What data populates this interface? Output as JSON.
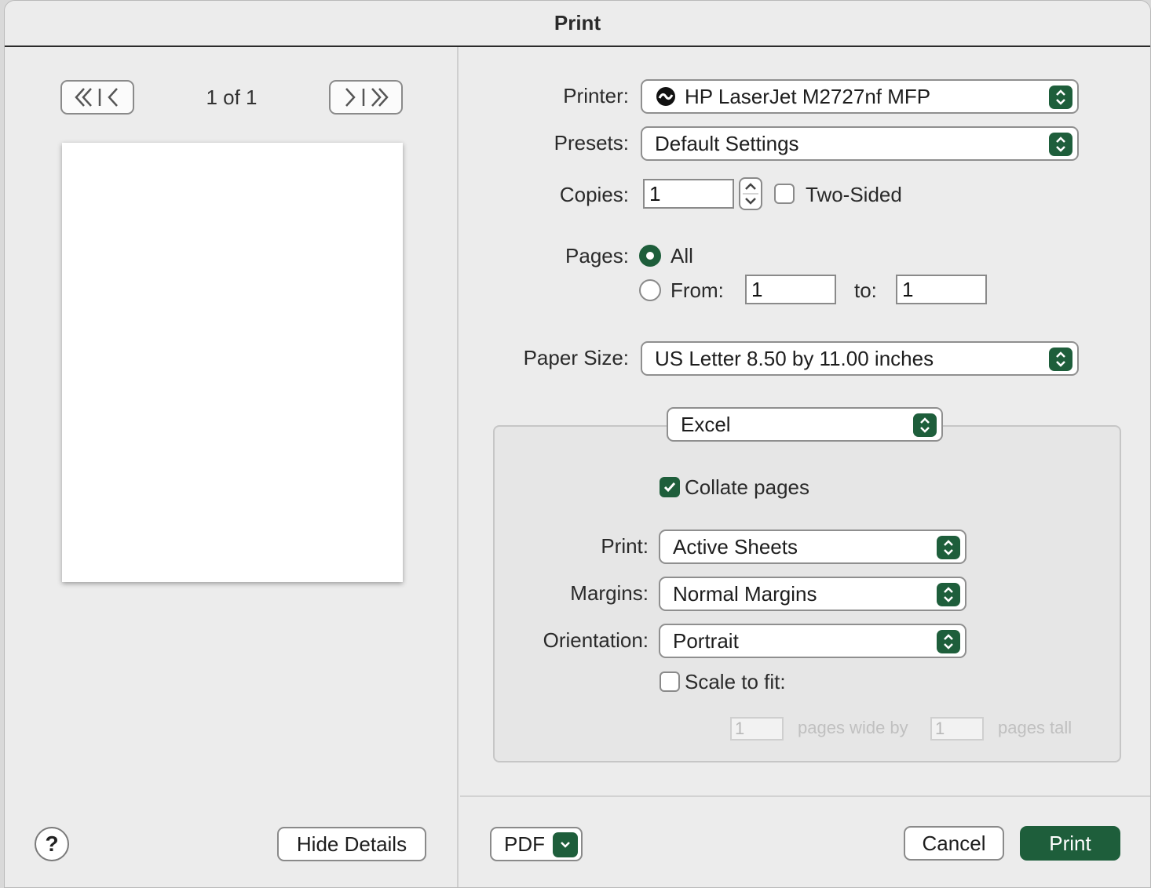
{
  "window": {
    "title": "Print"
  },
  "preview": {
    "page_indicator": "1 of 1"
  },
  "left_footer": {
    "help_label": "?",
    "hide_details_label": "Hide Details"
  },
  "printer": {
    "label": "Printer:",
    "value": "HP LaserJet M2727nf MFP"
  },
  "presets": {
    "label": "Presets:",
    "value": "Default Settings"
  },
  "copies": {
    "label": "Copies:",
    "value": "1",
    "two_sided_label": "Two-Sided",
    "two_sided_checked": false
  },
  "pages": {
    "label": "Pages:",
    "all_label": "All",
    "all_selected": true,
    "from_label": "From:",
    "from_value": "1",
    "to_label": "to:",
    "to_value": "1"
  },
  "paper_size": {
    "label": "Paper Size:",
    "value": "US Letter 8.50 by 11.00 inches"
  },
  "section": {
    "value": "Excel",
    "collate_label": "Collate pages",
    "collate_checked": true,
    "print": {
      "label": "Print:",
      "value": "Active Sheets"
    },
    "margins": {
      "label": "Margins:",
      "value": "Normal Margins"
    },
    "orientation": {
      "label": "Orientation:",
      "value": "Portrait"
    },
    "scale": {
      "label": "Scale to fit:",
      "checked": false,
      "wide_value": "1",
      "wide_label": "pages wide by",
      "tall_value": "1",
      "tall_label": "pages tall"
    }
  },
  "footer": {
    "pdf_label": "PDF",
    "cancel_label": "Cancel",
    "print_label": "Print"
  },
  "colors": {
    "accent": "#1e5e3b"
  }
}
